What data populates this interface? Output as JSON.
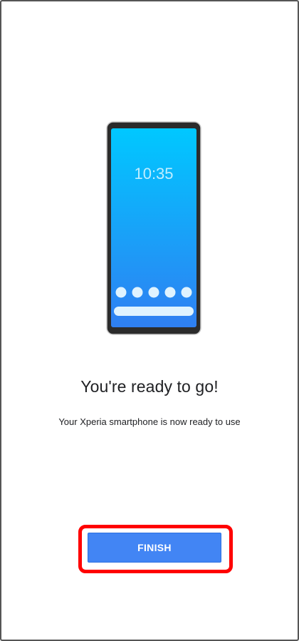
{
  "screen": {
    "illustration": {
      "clock_text": "10:35",
      "dock_dot_count": 5,
      "gradient_top": "#00c8ff",
      "gradient_bottom": "#2f7ff2",
      "bezel_color": "#2b2b2b"
    },
    "title": "You're ready to go!",
    "subtitle": "Your Xperia smartphone is now ready to use",
    "finish_button": {
      "label": "FINISH",
      "color": "#4285f4"
    },
    "highlight_color": "#ff0000"
  }
}
